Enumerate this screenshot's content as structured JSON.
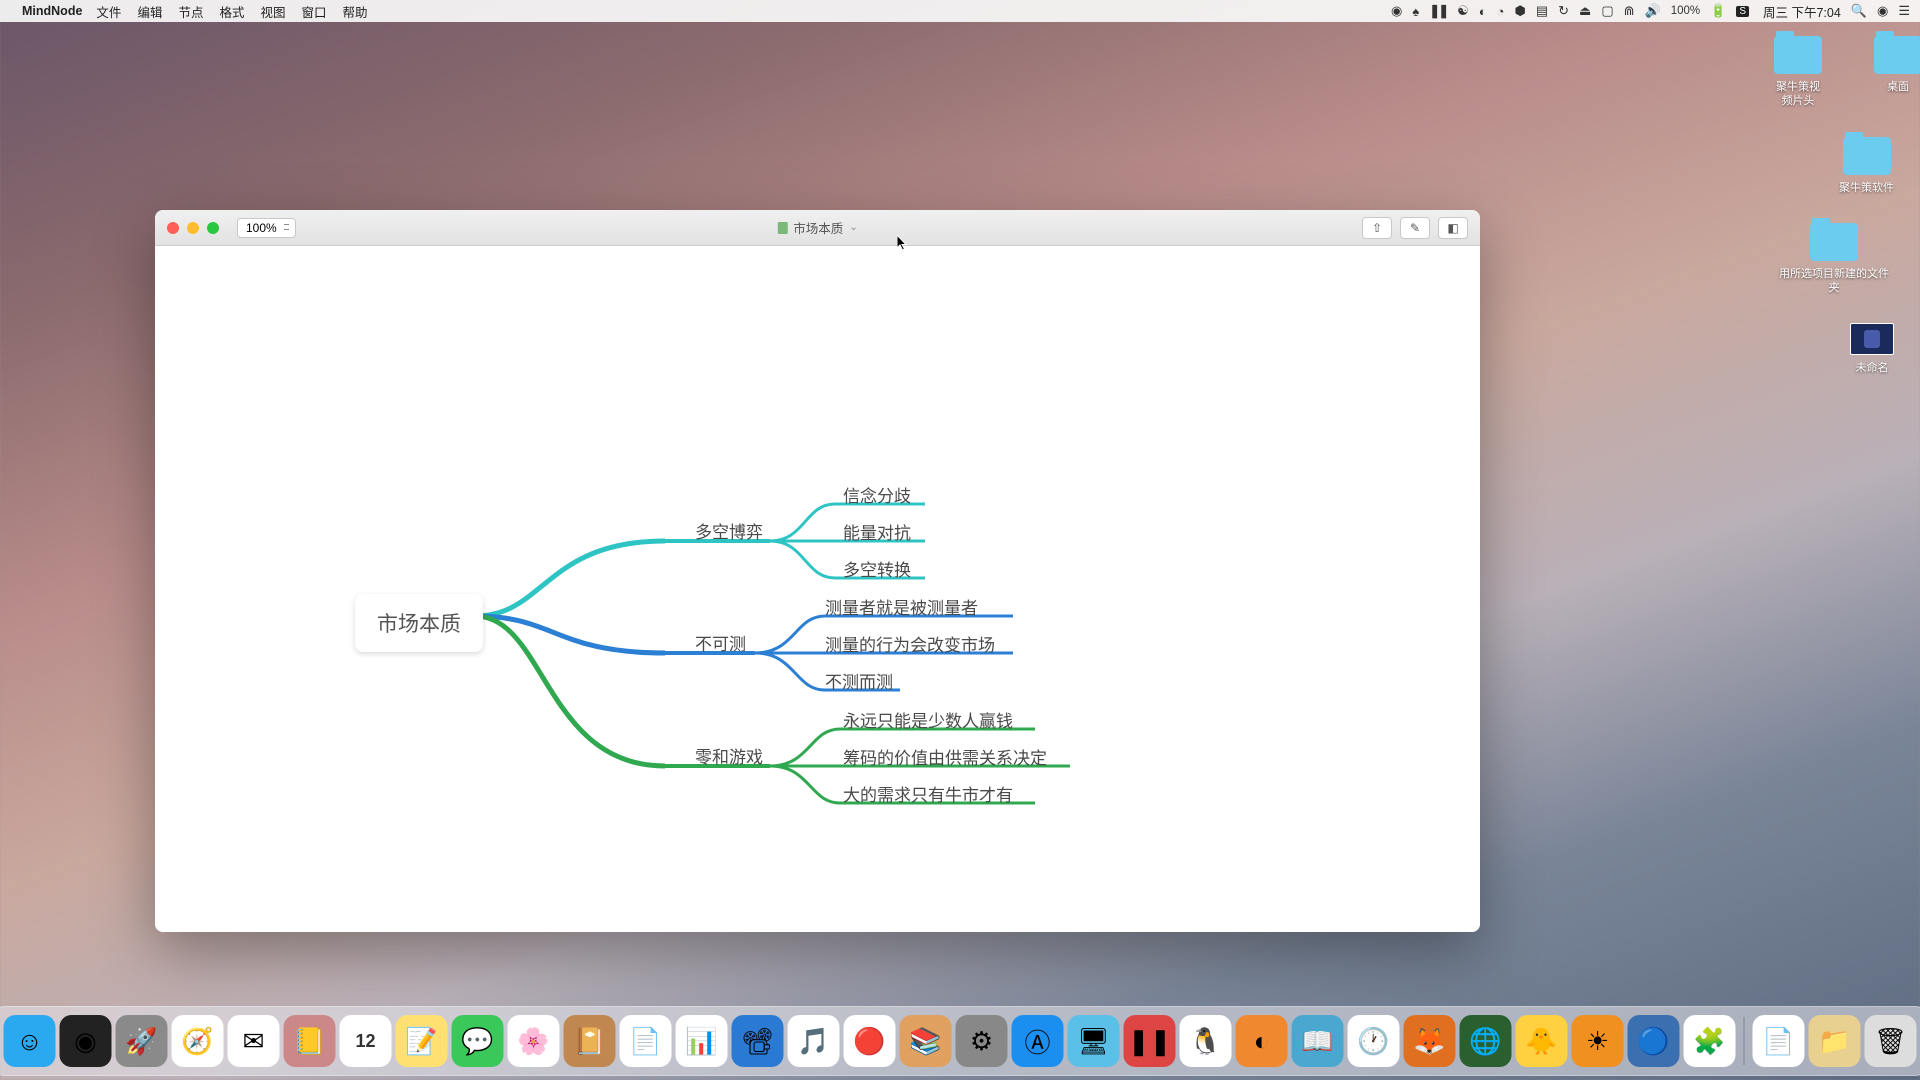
{
  "menubar": {
    "app_name": "MindNode",
    "menus": [
      "文件",
      "编辑",
      "节点",
      "格式",
      "视图",
      "窗口",
      "帮助"
    ],
    "battery": "100%",
    "clock": "周三 下午7:04"
  },
  "desktop": {
    "icons": [
      {
        "type": "folder",
        "label": "聚牛策视频片头"
      },
      {
        "type": "folder",
        "label": "桌面"
      },
      {
        "type": "folder",
        "label": "聚牛策软件"
      },
      {
        "type": "folder",
        "label": "用所选项目新建的文件夹"
      },
      {
        "type": "thumb",
        "label": "未命名"
      }
    ]
  },
  "window": {
    "zoom": "100%",
    "title": "市场本质",
    "toolbar_icons": [
      "share-icon",
      "brush-icon",
      "panel-icon"
    ]
  },
  "mindmap": {
    "root": "市场本质",
    "branches": [
      {
        "label": "多空博弈",
        "color": "#2fc4c4",
        "leaves": [
          "信念分歧",
          "能量对抗",
          "多空转换"
        ]
      },
      {
        "label": "不可测",
        "color": "#2b7fd4",
        "leaves": [
          "测量者就是被测量者",
          "测量的行为会改变市场",
          "不测而测"
        ]
      },
      {
        "label": "零和游戏",
        "color": "#2fa84f",
        "leaves": [
          "永远只能是少数人赢钱",
          "筹码的价值由供需关系决定",
          "大的需求只有牛市才有"
        ]
      }
    ]
  },
  "dock": {
    "apps": [
      {
        "name": "finder",
        "bg": "#2aa8f0",
        "glyph": "☺"
      },
      {
        "name": "siri",
        "bg": "#222",
        "glyph": "◉"
      },
      {
        "name": "launchpad",
        "bg": "#8a8a8a",
        "glyph": "🚀"
      },
      {
        "name": "safari",
        "bg": "#fff",
        "glyph": "🧭"
      },
      {
        "name": "mail",
        "bg": "#fff",
        "glyph": "✉"
      },
      {
        "name": "contacts",
        "bg": "#c88",
        "glyph": "📒"
      },
      {
        "name": "calendar",
        "bg": "#fff",
        "glyph": "12"
      },
      {
        "name": "notes",
        "bg": "#ffe070",
        "glyph": "📝"
      },
      {
        "name": "messages",
        "bg": "#3ac85a",
        "glyph": "💬"
      },
      {
        "name": "photos",
        "bg": "#fff",
        "glyph": "🌸"
      },
      {
        "name": "reminders",
        "bg": "#c08850",
        "glyph": "📔"
      },
      {
        "name": "pages",
        "bg": "#fff",
        "glyph": "📄"
      },
      {
        "name": "numbers",
        "bg": "#fff",
        "glyph": "📊"
      },
      {
        "name": "keynote",
        "bg": "#2a7ad4",
        "glyph": "📽"
      },
      {
        "name": "itunes",
        "bg": "#fff",
        "glyph": "🎵"
      },
      {
        "name": "chrome",
        "bg": "#fff",
        "glyph": "🔴"
      },
      {
        "name": "books",
        "bg": "#e0a060",
        "glyph": "📚"
      },
      {
        "name": "preferences",
        "bg": "#888",
        "glyph": "⚙"
      },
      {
        "name": "appstore",
        "bg": "#1a8ff0",
        "glyph": "Ⓐ"
      },
      {
        "name": "screenshot",
        "bg": "#5ac0e8",
        "glyph": "🖥"
      },
      {
        "name": "activity",
        "bg": "#d44",
        "glyph": "❚❚"
      },
      {
        "name": "qq",
        "bg": "#fff",
        "glyph": "🐧"
      },
      {
        "name": "uc",
        "bg": "#f08830",
        "glyph": "◐"
      },
      {
        "name": "reader",
        "bg": "#4aa8d0",
        "glyph": "📖"
      },
      {
        "name": "clock",
        "bg": "#fff",
        "glyph": "🕐"
      },
      {
        "name": "firefox",
        "bg": "#e07020",
        "glyph": "🦊"
      },
      {
        "name": "app1",
        "bg": "#2a6030",
        "glyph": "🌐"
      },
      {
        "name": "app2",
        "bg": "#ffd040",
        "glyph": "🐥"
      },
      {
        "name": "app3",
        "bg": "#f09020",
        "glyph": "☀"
      },
      {
        "name": "app4",
        "bg": "#3a70b0",
        "glyph": "🔵"
      },
      {
        "name": "mindnode",
        "bg": "#fff",
        "glyph": "🧩"
      }
    ],
    "right": [
      {
        "name": "doc",
        "bg": "#fff",
        "glyph": "📄"
      },
      {
        "name": "folder",
        "bg": "#e8d090",
        "glyph": "📁"
      },
      {
        "name": "trash",
        "bg": "#ddd",
        "glyph": "🗑"
      }
    ]
  }
}
